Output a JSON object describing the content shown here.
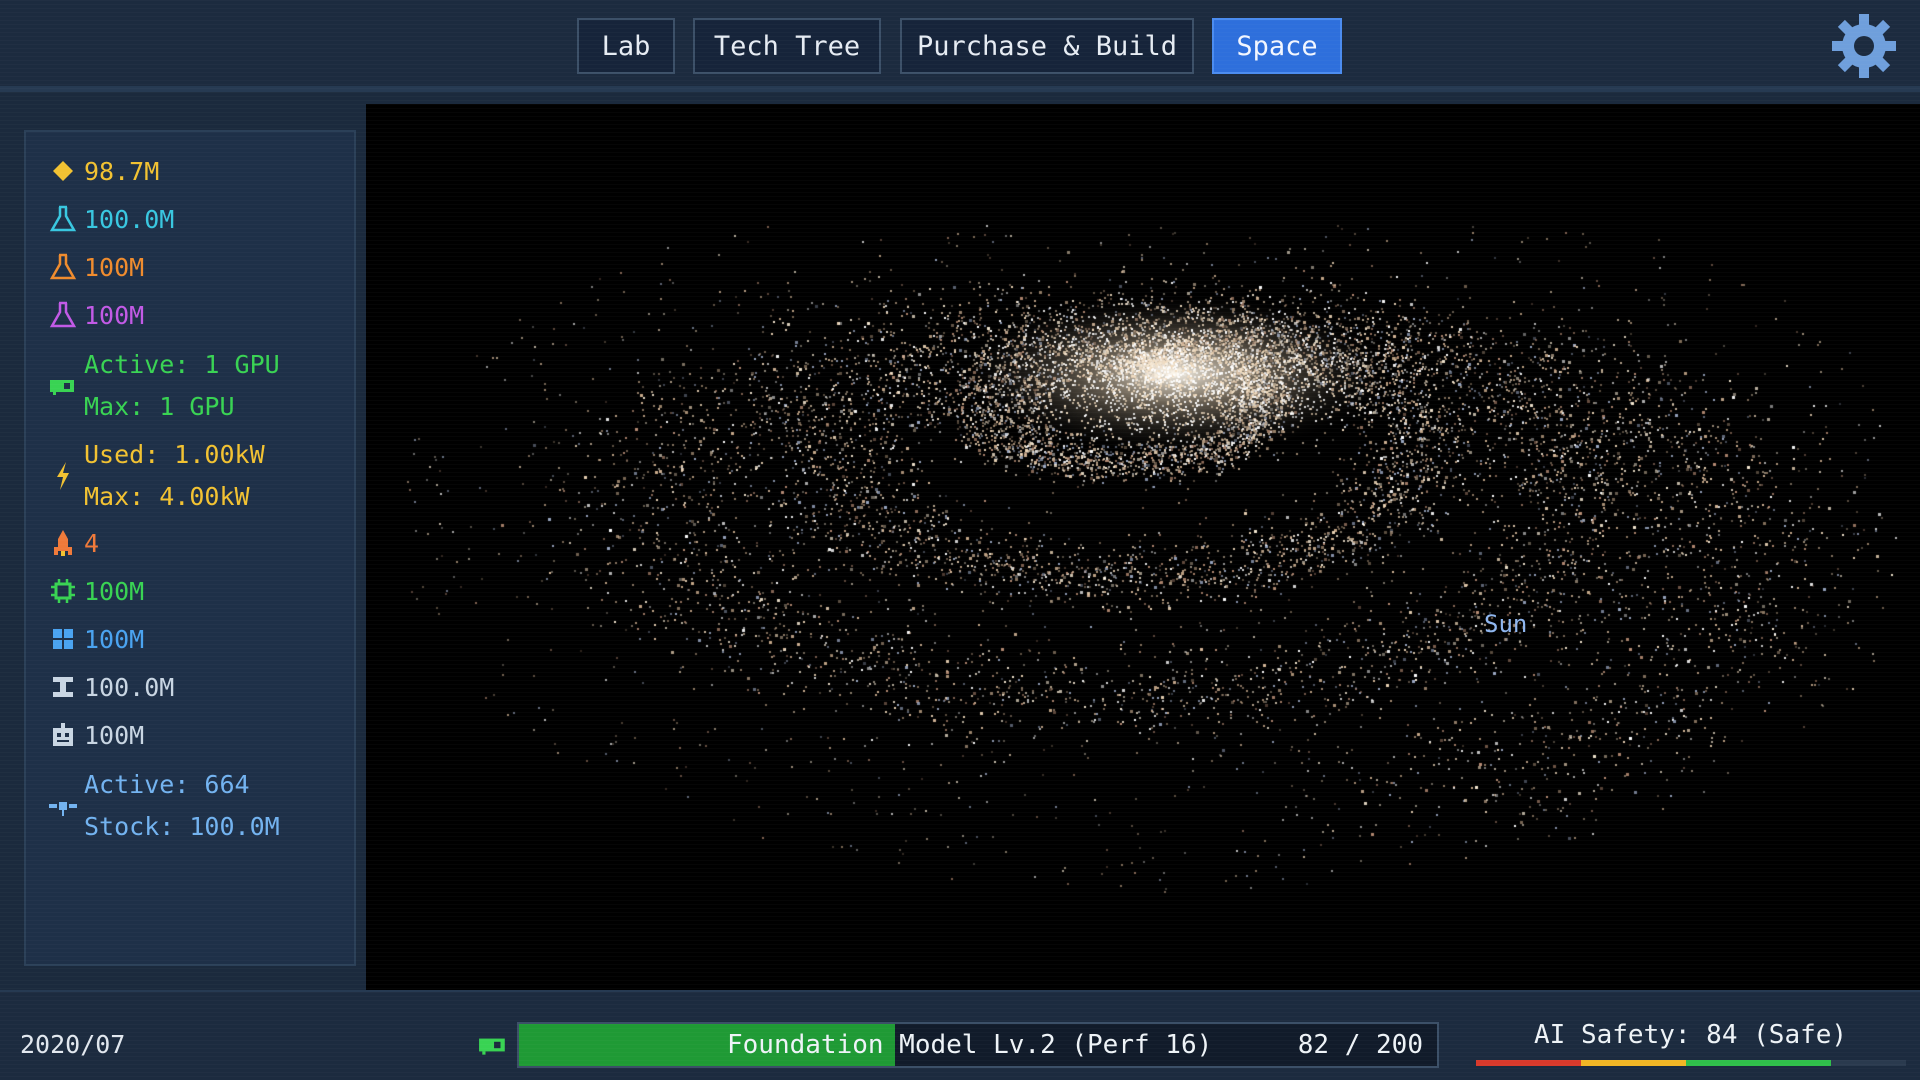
{
  "nav": {
    "tabs": [
      {
        "label": "Lab",
        "active": false
      },
      {
        "label": "Tech Tree",
        "active": false
      },
      {
        "label": "Purchase & Build",
        "active": false
      },
      {
        "label": "Space",
        "active": true
      }
    ],
    "settings_icon": "gear-icon"
  },
  "resources": {
    "money": {
      "icon": "diamond-icon",
      "value": "98.7M",
      "color": "#f2c232"
    },
    "science_cyan": {
      "icon": "flask-icon",
      "value": "100.0M",
      "color": "#39c7e0"
    },
    "science_orange": {
      "icon": "flask-icon",
      "value": "100M",
      "color": "#f08c2e"
    },
    "science_purple": {
      "icon": "flask-icon",
      "value": "100M",
      "color": "#c25ae6"
    },
    "gpu": {
      "icon": "gpu-icon",
      "active": "Active: 1 GPU",
      "max": "Max: 1 GPU",
      "color": "#39d353"
    },
    "power": {
      "icon": "lightning-icon",
      "used": "Used: 1.00kW",
      "max": "Max: 4.00kW",
      "color": "#f2c232"
    },
    "rockets": {
      "icon": "rocket-icon",
      "value": "4",
      "color": "#f07a3a"
    },
    "components": {
      "icon": "chip-icon",
      "value": "100M",
      "color": "#39d353"
    },
    "solar": {
      "icon": "grid-icon",
      "value": "100M",
      "color": "#4aa3f0"
    },
    "materials": {
      "icon": "beam-icon",
      "value": "100.0M",
      "color": "#c9d6e3"
    },
    "robots": {
      "icon": "robot-icon",
      "value": "100M",
      "color": "#c9d6e3"
    },
    "satellites": {
      "icon": "satellite-icon",
      "active": "Active: 664",
      "stock": "Stock: 100.0M",
      "color": "#73b3f0"
    }
  },
  "space": {
    "sun_label": "Sun"
  },
  "status": {
    "date": "2020/07",
    "model_label": "Foundation Model Lv.2 (Perf 16)",
    "progress": {
      "current": 82,
      "max": 200,
      "text": "82 / 200"
    },
    "safety": {
      "text": "AI Safety: 84 (Safe)",
      "value": 84
    }
  },
  "colors": {
    "accent": "#2e6fdc",
    "progress_fill": "#1f9a35",
    "safety_red": "#d9392b",
    "safety_yellow": "#f2b624",
    "safety_green": "#2fbf4a"
  }
}
